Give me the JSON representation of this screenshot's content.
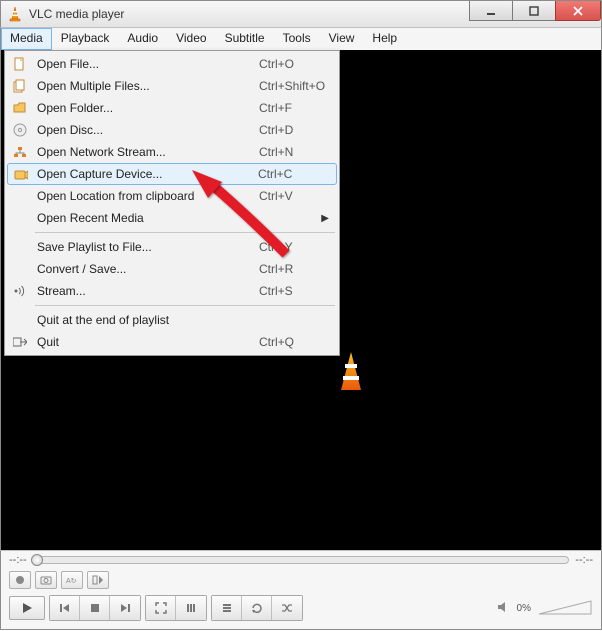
{
  "window": {
    "title": "VLC media player"
  },
  "menubar": {
    "items": [
      "Media",
      "Playback",
      "Audio",
      "Video",
      "Subtitle",
      "Tools",
      "View",
      "Help"
    ],
    "activeIndex": 0
  },
  "dropdown": {
    "highlightedIndex": 5,
    "items": [
      {
        "icon": "file-icon",
        "label": "Open File...",
        "shortcut": "Ctrl+O"
      },
      {
        "icon": "files-icon",
        "label": "Open Multiple Files...",
        "shortcut": "Ctrl+Shift+O"
      },
      {
        "icon": "folder-icon",
        "label": "Open Folder...",
        "shortcut": "Ctrl+F"
      },
      {
        "icon": "disc-icon",
        "label": "Open Disc...",
        "shortcut": "Ctrl+D"
      },
      {
        "icon": "network-icon",
        "label": "Open Network Stream...",
        "shortcut": "Ctrl+N"
      },
      {
        "icon": "capture-icon",
        "label": "Open Capture Device...",
        "shortcut": "Ctrl+C"
      },
      {
        "icon": "",
        "label": "Open Location from clipboard",
        "shortcut": "Ctrl+V"
      },
      {
        "icon": "",
        "label": "Open Recent Media",
        "shortcut": "",
        "submenu": true
      },
      {
        "sep": true
      },
      {
        "icon": "",
        "label": "Save Playlist to File...",
        "shortcut": "Ctrl+Y"
      },
      {
        "icon": "",
        "label": "Convert / Save...",
        "shortcut": "Ctrl+R"
      },
      {
        "icon": "stream-icon",
        "label": "Stream...",
        "shortcut": "Ctrl+S"
      },
      {
        "sep": true
      },
      {
        "icon": "",
        "label": "Quit at the end of playlist",
        "shortcut": ""
      },
      {
        "icon": "quit-icon",
        "label": "Quit",
        "shortcut": "Ctrl+Q"
      }
    ]
  },
  "player": {
    "time_current": "--:--",
    "time_total": "--:--",
    "volume_percent": "0%"
  }
}
